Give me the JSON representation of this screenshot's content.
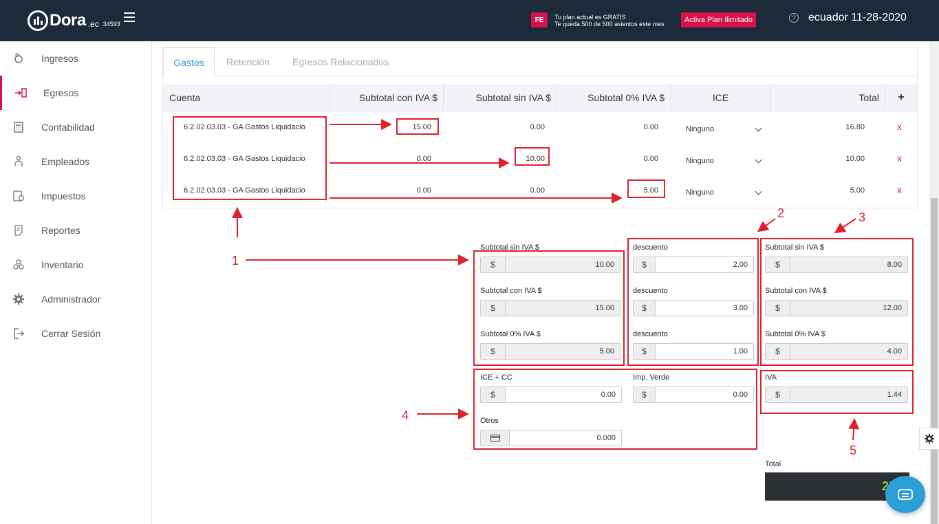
{
  "header": {
    "brand": "Dora",
    "brand_suffix": ".ec",
    "account_number": "34593",
    "badge": "FE",
    "plan_line1": "Tu plan actual es GRATIS",
    "plan_line2": "Te queda 500 de 500 asientos este mes",
    "plan_button": "Activa Plan Ilimitado",
    "help": "?",
    "user_date": "ecuador 11-28-2020"
  },
  "sidebar": {
    "items": [
      {
        "label": "Ingresos",
        "icon": "piggy-bank-icon"
      },
      {
        "label": "Egresos",
        "icon": "transfer-out-icon"
      },
      {
        "label": "Contabilidad",
        "icon": "calculator-icon"
      },
      {
        "label": "Empleados",
        "icon": "people-icon"
      },
      {
        "label": "Impuestos",
        "icon": "tax-document-icon"
      },
      {
        "label": "Reportes",
        "icon": "report-icon"
      },
      {
        "label": "Inventario",
        "icon": "boxes-icon"
      },
      {
        "label": "Administrador",
        "icon": "gear-icon"
      },
      {
        "label": "Cerrar Sesión",
        "icon": "logout-icon"
      }
    ]
  },
  "tabs": [
    "Gastos",
    "Retención",
    "Egresos Relacionados"
  ],
  "table": {
    "columns": [
      "Cuenta",
      "Subtotal con IVA $",
      "Subtotal sin IVA $",
      "Subtotal 0% IVA $",
      "ICE",
      "Total",
      "+"
    ],
    "rows": [
      {
        "cuenta": "6.2.02.03.03 - GA Gastos Liquidacio",
        "con_iva": "15.00",
        "sin_iva": "0.00",
        "cero_iva": "0.00",
        "ice": "Ninguno",
        "total": "16.80",
        "delete": "x"
      },
      {
        "cuenta": "6.2.02.03.03 - GA Gastos Liquidacio",
        "con_iva": "0.00",
        "sin_iva": "10.00",
        "cero_iva": "0.00",
        "ice": "Ninguno",
        "total": "10.00",
        "delete": "x"
      },
      {
        "cuenta": "6.2.02.03.03 - GA Gastos Liquidacio",
        "con_iva": "0.00",
        "sin_iva": "0.00",
        "cero_iva": "5.00",
        "ice": "Ninguno",
        "total": "5.00",
        "delete": "x"
      }
    ]
  },
  "summary": {
    "currency": "$",
    "subtotal_sin_iva_label": "Subtotal sin IVA $",
    "subtotal_sin_iva": "10.00",
    "subtotal_con_iva_label": "Subtotal con IVA $",
    "subtotal_con_iva": "15.00",
    "subtotal_cero_label": "Subtotal 0% IVA $",
    "subtotal_cero": "5.00",
    "descuento_label": "descuento",
    "descuento_1": "2.00",
    "descuento_2": "3.00",
    "descuento_3": "1.00",
    "net_sin_iva": "8.00",
    "net_con_iva": "12.00",
    "net_cero": "4.00",
    "ice_cc_label": "ICE + CC",
    "ice_cc": "0.00",
    "imp_verde_label": "Imp. Verde",
    "imp_verde": "0.00",
    "otros_label": "Otros",
    "otros": "0.000",
    "iva_label": "IVA",
    "iva": "1.44",
    "total_label": "Total",
    "total": "25"
  },
  "annotations": [
    "1",
    "1",
    "2",
    "3",
    "4",
    "5"
  ],
  "colors": {
    "topbar": "#1c2a3a",
    "accent": "#d6124a",
    "link": "#2a9fd6",
    "annotation": "#e0202a",
    "total_value": "#8fd14f"
  }
}
